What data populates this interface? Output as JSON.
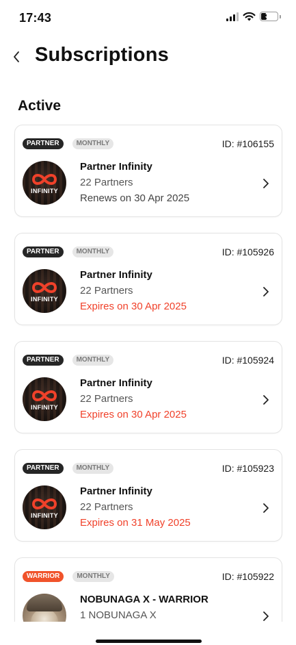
{
  "status_bar": {
    "time": "17:43",
    "battery": "30"
  },
  "header": {
    "title": "Subscriptions",
    "back_icon": "chevron-left-icon"
  },
  "section": {
    "title": "Active"
  },
  "subscriptions": [
    {
      "type": "PARTNER",
      "period": "MONTHLY",
      "id": "ID: #106155",
      "name": "Partner Infinity",
      "partners": "22 Partners",
      "status_text": "Renews on 30 Apr 2025",
      "status": "renews",
      "avatar_label": "INFINITY"
    },
    {
      "type": "PARTNER",
      "period": "MONTHLY",
      "id": "ID: #105926",
      "name": "Partner Infinity",
      "partners": "22 Partners",
      "status_text": "Expires on 30 Apr 2025",
      "status": "expires",
      "avatar_label": "INFINITY"
    },
    {
      "type": "PARTNER",
      "period": "MONTHLY",
      "id": "ID: #105924",
      "name": "Partner Infinity",
      "partners": "22 Partners",
      "status_text": "Expires on 30 Apr 2025",
      "status": "expires",
      "avatar_label": "INFINITY"
    },
    {
      "type": "PARTNER",
      "period": "MONTHLY",
      "id": "ID: #105923",
      "name": "Partner Infinity",
      "partners": "22 Partners",
      "status_text": "Expires on 31 May 2025",
      "status": "expires",
      "avatar_label": "INFINITY"
    },
    {
      "type": "WARRIOR",
      "period": "MONTHLY",
      "id": "ID: #105922",
      "name": "NOBUNAGA X - WARRIOR",
      "partners": "1 NOBUNAGA X",
      "status_text": "",
      "status": "",
      "avatar_label": ""
    }
  ],
  "colors": {
    "expire": "#f0412a",
    "warrior_badge": "#f0532b",
    "partner_badge": "#262626"
  }
}
